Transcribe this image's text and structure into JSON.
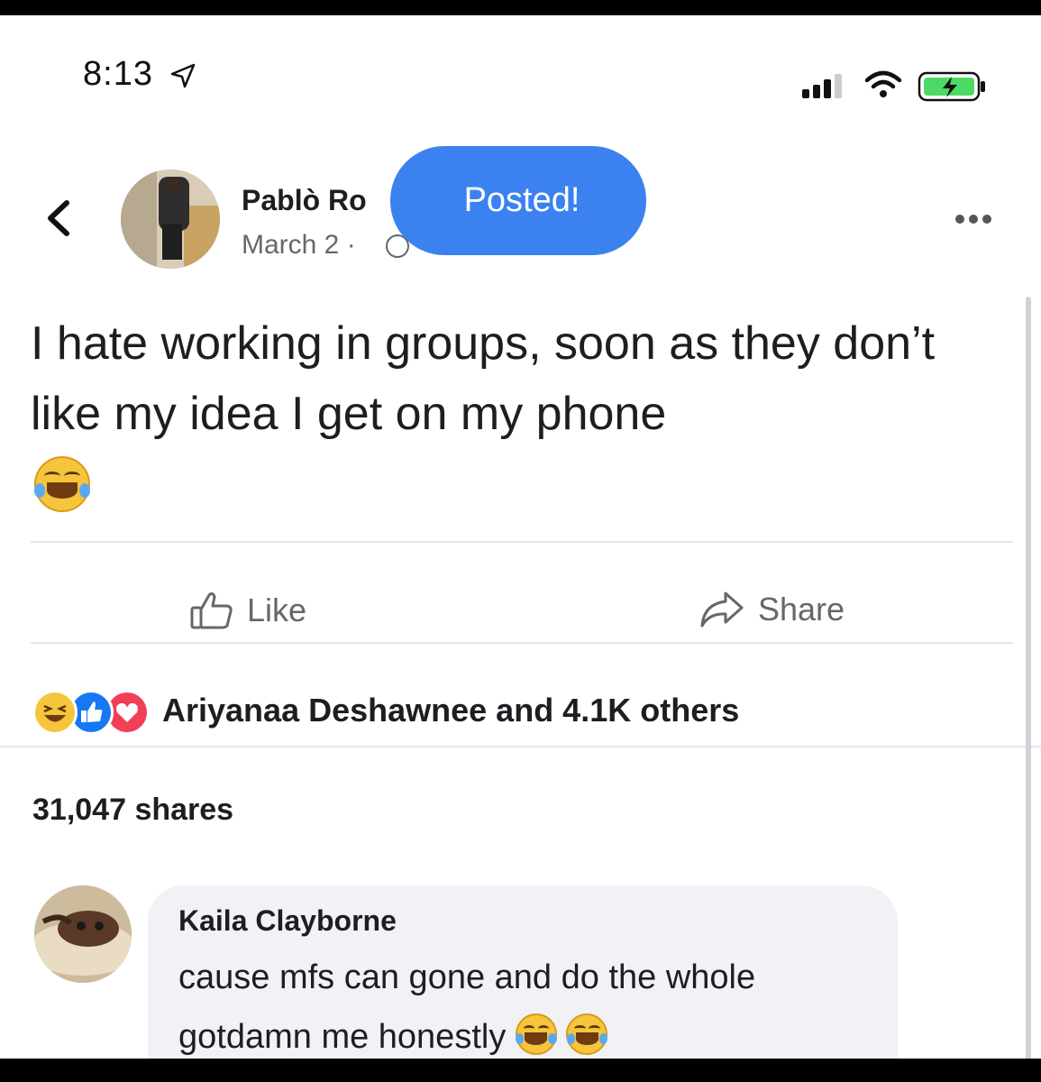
{
  "status_bar": {
    "time": "8:13"
  },
  "post": {
    "author": "Pablò Ro",
    "date": "March 2 ·",
    "toast": "Posted!",
    "text": "I hate working in groups, soon as they don’t like my idea I get on my phone",
    "actions": {
      "like": "Like",
      "share": "Share"
    },
    "reactions_summary": "Ariyanaa Deshawnee and 4.1K others",
    "shares": "31,047 shares"
  },
  "comment": {
    "author": "Kaila Clayborne",
    "text": "cause mfs can gone and do the whole gotdamn me honestly"
  },
  "icons": [
    "location-arrow-icon",
    "signal-icon",
    "wifi-icon",
    "battery-charging-icon",
    "back-chevron-icon",
    "globe-icon",
    "more-icon",
    "laughing-emoji",
    "like-icon",
    "share-icon",
    "haha-reaction-icon",
    "like-reaction-icon",
    "love-reaction-icon"
  ],
  "colors": {
    "toast": "#3b82f0",
    "like_reaction": "#1877f2",
    "love_reaction": "#f33e58",
    "haha_reaction": "#f7c53b"
  }
}
